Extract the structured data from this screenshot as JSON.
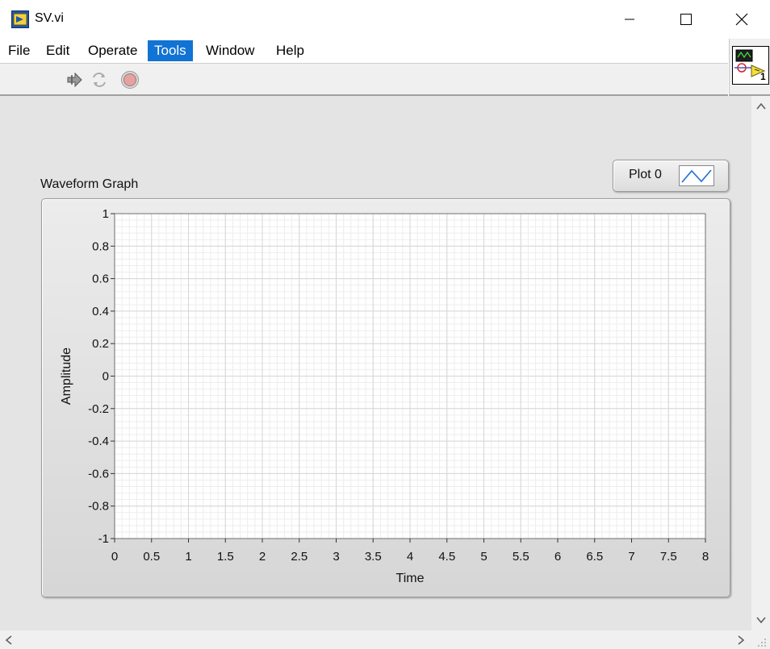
{
  "window": {
    "title": "SV.vi",
    "vi_icon_counter": "1"
  },
  "menu": [
    {
      "label": "File",
      "active": false
    },
    {
      "label": "Edit",
      "active": false
    },
    {
      "label": "Operate",
      "active": false
    },
    {
      "label": "Tools",
      "active": true
    },
    {
      "label": "Window",
      "active": false
    },
    {
      "label": "Help",
      "active": false
    }
  ],
  "toolbar": {
    "icons": [
      "run-continuously-icon",
      "run-icon",
      "abort-icon"
    ]
  },
  "legend": {
    "plot_name": "Plot 0",
    "line_color": "#1e6fd9"
  },
  "colors": {
    "menu_active": "#1173d4",
    "panel": "#e4e4e4",
    "plot_background": "#ffffff"
  },
  "chart_data": {
    "type": "line",
    "title": "Waveform Graph",
    "xlabel": "Time",
    "ylabel": "Amplitude",
    "xlim": [
      0,
      8
    ],
    "ylim": [
      -1,
      1
    ],
    "x_ticks": [
      "0",
      "0.5",
      "1",
      "1.5",
      "2",
      "2.5",
      "3",
      "3.5",
      "4",
      "4.5",
      "5",
      "5.5",
      "6",
      "6.5",
      "7",
      "7.5",
      "8"
    ],
    "y_ticks": [
      "1",
      "0.8",
      "0.6",
      "0.4",
      "0.2",
      "0",
      "-0.2",
      "-0.4",
      "-0.6",
      "-0.8",
      "-1"
    ],
    "grid": true,
    "series": [
      {
        "name": "Plot 0",
        "values": []
      }
    ]
  }
}
